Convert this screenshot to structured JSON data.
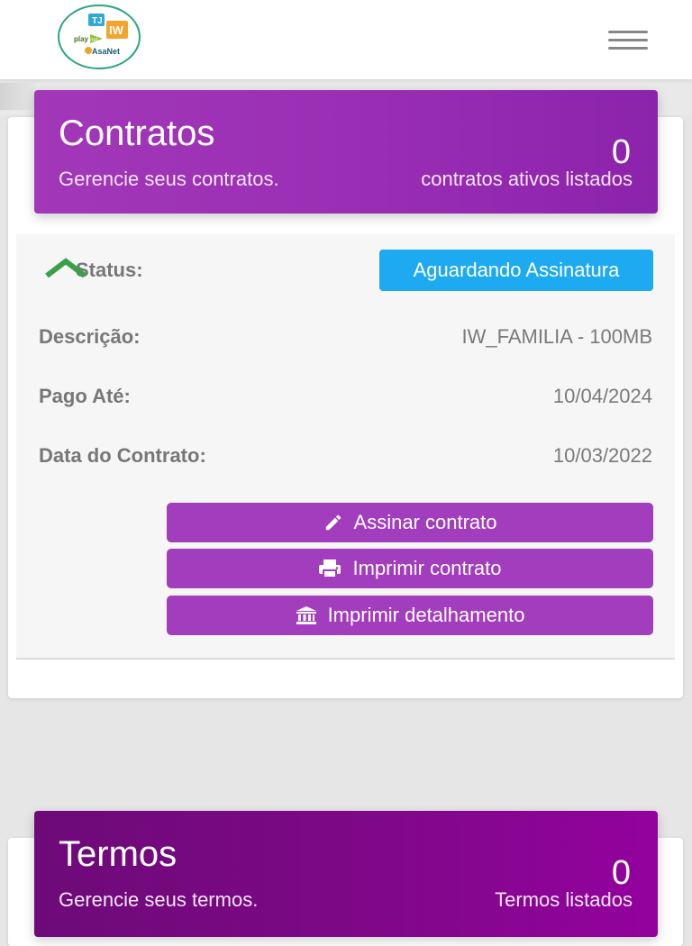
{
  "navbar": {
    "logo_name": "TJ IW playnet AsaNet",
    "menu_icon": "hamburger-icon"
  },
  "contratos": {
    "title": "Contratos",
    "subtitle": "Gerencie seus contratos.",
    "count": "0",
    "count_label": "contratos ativos listados"
  },
  "contract": {
    "status_label": "Status:",
    "status_value": "Aguardando Assinatura",
    "status_color": "#1eaaf1",
    "descricao_label": "Descrição:",
    "descricao_value": "IW_FAMILIA - 100MB",
    "pago_label": "Pago Até:",
    "pago_value": "10/04/2024",
    "data_label": "Data do Contrato:",
    "data_value": "10/03/2022",
    "collapse_icon": "chevron-up-icon"
  },
  "actions": {
    "assinar_label": "Assinar contrato",
    "assinar_icon": "pencil-icon",
    "imprimir_label": "Imprimir contrato",
    "imprimir_icon": "printer-icon",
    "detalhamento_label": "Imprimir detalhamento",
    "detalhamento_icon": "bank-icon",
    "button_color": "#a23dbd"
  },
  "termos": {
    "title": "Termos",
    "subtitle": "Gerencie seus termos.",
    "count": "0",
    "count_label": "Termos listados"
  },
  "colors": {
    "contratos_header": "#9a2fb5",
    "termos_header": "#7d0886",
    "accent_green": "#3aa04a"
  }
}
